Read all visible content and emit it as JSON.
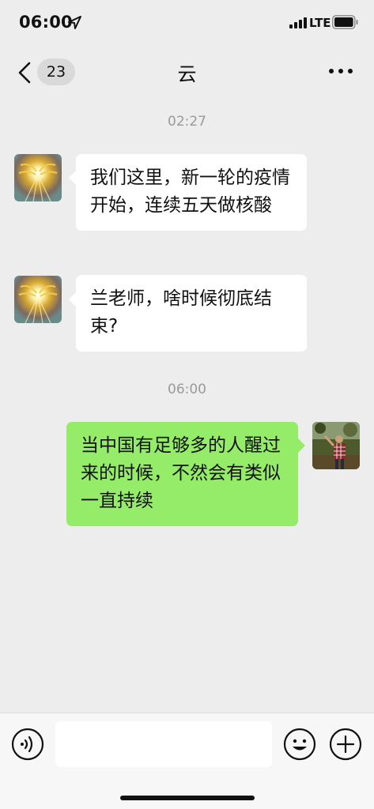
{
  "status_bar": {
    "time": "06:00",
    "network": "LTE",
    "icons": [
      "location-arrow-icon",
      "signal-bars-icon",
      "battery-icon"
    ]
  },
  "nav": {
    "back_icon": "chevron-left-icon",
    "unread_count": "23",
    "title": "云",
    "more_icon": "ellipsis-icon"
  },
  "messages": [
    {
      "type": "timestamp",
      "text": "02:27"
    },
    {
      "type": "incoming",
      "avatar": "golden-light-avatar",
      "text": "我们这里，新一轮的疫情开始，连续五天做核酸"
    },
    {
      "type": "incoming",
      "avatar": "golden-light-avatar",
      "text": "兰老师，啥时候彻底结束?"
    },
    {
      "type": "timestamp",
      "text": "06:00"
    },
    {
      "type": "outgoing",
      "avatar": "user-photo-avatar",
      "text": "当中国有足够多的人醒过来的时候，不然会有类似一直持续"
    }
  ],
  "input_bar": {
    "voice_icon": "voice-icon",
    "input_value": "",
    "emoji_icon": "emoji-icon",
    "plus_icon": "plus-icon"
  },
  "colors": {
    "background": "#ededed",
    "incoming_bubble": "#ffffff",
    "outgoing_bubble": "#95ec69",
    "timestamp_text": "#9a9a9a"
  }
}
